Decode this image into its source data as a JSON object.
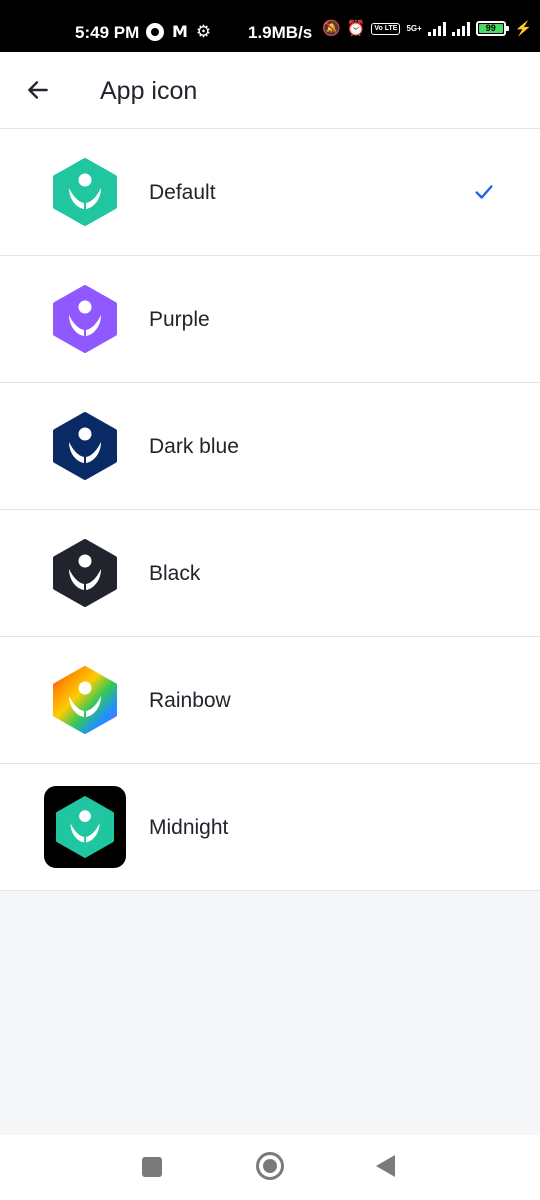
{
  "status_bar": {
    "time": "5:49 PM",
    "network_speed": "1.9MB/s",
    "network_type": "5G+",
    "volte": "Vo LTE",
    "battery": "99"
  },
  "header": {
    "title": "App icon",
    "back_icon": "arrow-left-icon"
  },
  "options": [
    {
      "label": "Default",
      "color": "#1fc69f",
      "selected": true
    },
    {
      "label": "Purple",
      "color": "#9059ff",
      "selected": false
    },
    {
      "label": "Dark blue",
      "color": "#0a2a66",
      "selected": false
    },
    {
      "label": "Black",
      "color": "#21242c",
      "selected": false
    },
    {
      "label": "Rainbow",
      "color": "rainbow",
      "selected": false
    },
    {
      "label": "Midnight",
      "color": "#1fc69f",
      "background": "#000000",
      "selected": false
    }
  ],
  "accent_color": "#1865f2",
  "nav_bar": {
    "icons": [
      "recents-square-icon",
      "home-circle-icon",
      "back-triangle-icon"
    ]
  }
}
